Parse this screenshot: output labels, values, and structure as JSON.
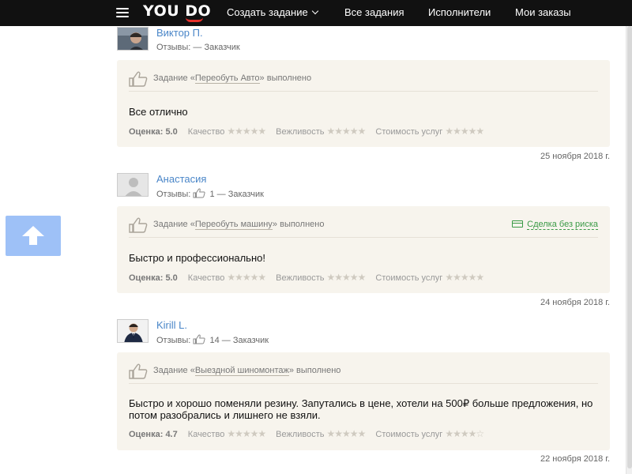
{
  "header": {
    "logo": "YOU DO",
    "nav": [
      {
        "label": "Создать задание",
        "has_dropdown": true
      },
      {
        "label": "Все задания"
      },
      {
        "label": "Исполнители"
      },
      {
        "label": "Мои заказы"
      }
    ],
    "hidden_date_fragment": "2018 г."
  },
  "colors": {
    "header": "#111111",
    "link": "#4a86c8",
    "card": "#f7f4ed",
    "safe_deal": "#3a9a46",
    "to_top": "#9ec1f7"
  },
  "reviews": [
    {
      "author": "Виктор П.",
      "reviews_prefix": "Отзывы:",
      "reviews_count": "",
      "reviews_suffix": "— Заказчик",
      "task_prefix": "Задание «",
      "task_name": "Переобуть Авто",
      "task_suffix": "» выполнено",
      "safe_deal": "",
      "text": "Все отлично",
      "score_label": "Оценка:",
      "score": "5.0",
      "quality_label": "Качество",
      "quality_stars": "★★★★★",
      "politeness_label": "Вежливость",
      "politeness_stars": "★★★★★",
      "price_label": "Стоимость услуг",
      "price_stars": "★★★★★",
      "date": "25 ноября 2018 г."
    },
    {
      "author": "Анастасия",
      "reviews_prefix": "Отзывы:",
      "reviews_count": "1",
      "reviews_suffix": "— Заказчик",
      "task_prefix": "Задание «",
      "task_name": "Переобуть машину",
      "task_suffix": "» выполнено",
      "safe_deal": "Сделка без риска",
      "text": "Быстро и профессионально!",
      "score_label": "Оценка:",
      "score": "5.0",
      "quality_label": "Качество",
      "quality_stars": "★★★★★",
      "politeness_label": "Вежливость",
      "politeness_stars": "★★★★★",
      "price_label": "Стоимость услуг",
      "price_stars": "★★★★★",
      "date": "24 ноября 2018 г."
    },
    {
      "author": "Kirill L.",
      "reviews_prefix": "Отзывы:",
      "reviews_count": "14",
      "reviews_suffix": "— Заказчик",
      "task_prefix": "Задание «",
      "task_name": "Выездной шиномонтаж",
      "task_suffix": "» выполнено",
      "safe_deal": "",
      "text": "Быстро и хорошо поменяли резину. Запутались в цене, хотели на 500₽ больше предложения, но потом разобрались и лишнего не взяли.",
      "score_label": "Оценка:",
      "score": "4.7",
      "quality_label": "Качество",
      "quality_stars": "★★★★★",
      "politeness_label": "Вежливость",
      "politeness_stars": "★★★★★",
      "price_label": "Стоимость услуг",
      "price_stars": "★★★★☆",
      "date": "22 ноября 2018 г."
    }
  ],
  "icons": {
    "to_top": "arrow-up-icon",
    "like": "thumbs-up-icon",
    "menu": "hamburger-icon",
    "safe_deal": "credit-card-icon"
  }
}
